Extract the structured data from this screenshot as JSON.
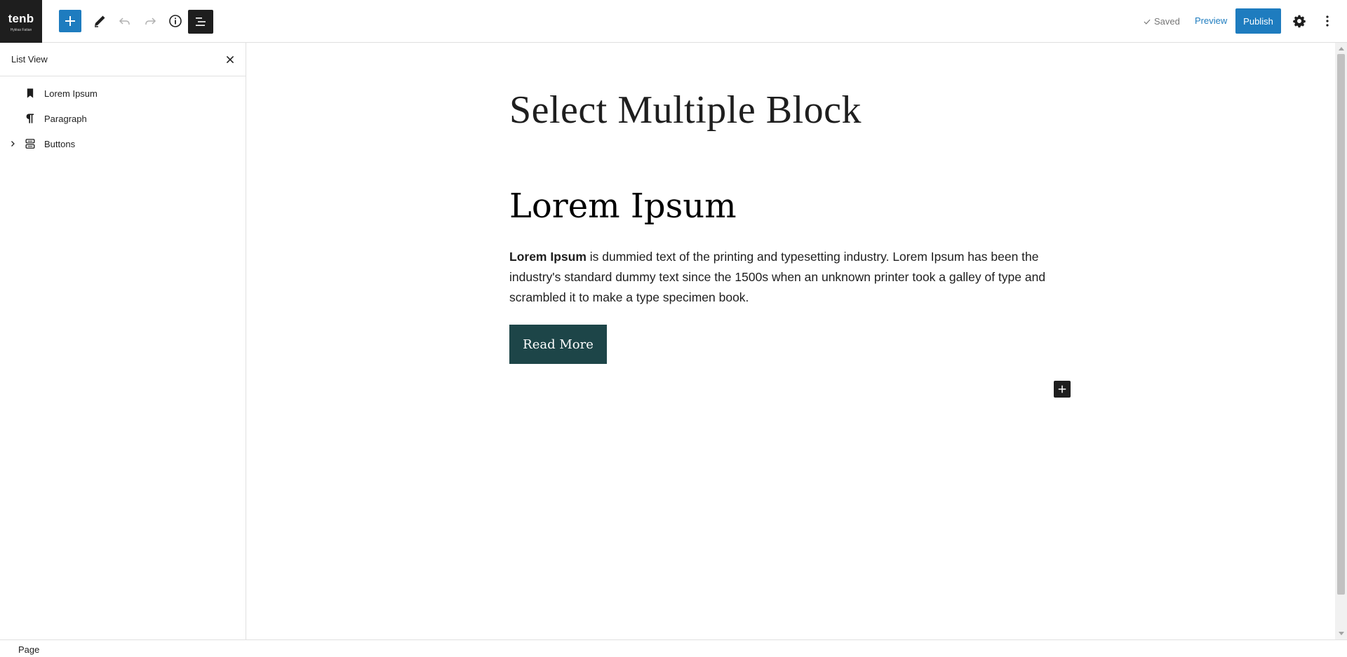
{
  "header": {
    "logo": {
      "word": "tenb",
      "tagline": "Hyléas Fatian"
    },
    "saved_label": "Saved",
    "preview_label": "Preview",
    "publish_label": "Publish"
  },
  "list_view": {
    "title": "List View",
    "items": [
      {
        "label": "Lorem Ipsum",
        "icon": "bookmark-icon",
        "expandable": false
      },
      {
        "label": "Paragraph",
        "icon": "paragraph-icon",
        "expandable": false
      },
      {
        "label": "Buttons",
        "icon": "buttons-icon",
        "expandable": true
      }
    ]
  },
  "editor": {
    "page_title": "Select Multiple Block",
    "heading": "Lorem Ipsum",
    "paragraph_bold": "Lorem Ipsum",
    "paragraph_rest": " is dummied text of the printing and typesetting industry. Lorem Ipsum has been the industry's standard dummy text since the 1500s when an unknown printer took a galley of type and scrambled it to make a type specimen book.",
    "button_label": "Read More"
  },
  "footer": {
    "breadcrumb": "Page"
  },
  "colors": {
    "accent": "#1e7cbf",
    "dark": "#1e1e1e",
    "button_bg": "#1d4548"
  }
}
